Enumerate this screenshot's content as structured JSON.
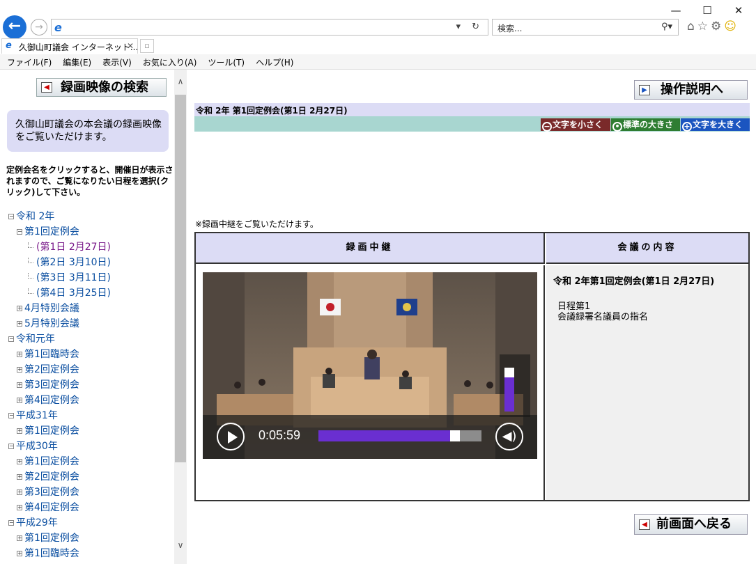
{
  "browser": {
    "tab_title": "久御山町議会 インターネット...",
    "search_placeholder": "検索...",
    "window_minimize": "—",
    "window_maximize": "☐",
    "window_close": "✕",
    "menu": [
      "ファイル(F)",
      "編集(E)",
      "表示(V)",
      "お気に入り(A)",
      "ツール(T)",
      "ヘルプ(H)"
    ]
  },
  "sidebar": {
    "search_button": "録画映像の検索",
    "info": "久御山町議会の本会議の録画映像をご覧いただけます。",
    "instructions": "定例会名をクリックすると、開催日が表示されますので、ご覧になりたい日程を選択(クリック)して下さい。",
    "tree": [
      {
        "label": "令和 2年",
        "level": 0,
        "state": "open"
      },
      {
        "label": "第1回定例会",
        "level": 1,
        "state": "open"
      },
      {
        "label": "(第1日 2月27日)",
        "level": 2,
        "state": "leaf",
        "active": true
      },
      {
        "label": "(第2日 3月10日)",
        "level": 2,
        "state": "leaf"
      },
      {
        "label": "(第3日 3月11日)",
        "level": 2,
        "state": "leaf"
      },
      {
        "label": "(第4日 3月25日)",
        "level": 2,
        "state": "leaf"
      },
      {
        "label": "4月特別会議",
        "level": 1,
        "state": "closed"
      },
      {
        "label": "5月特別会議",
        "level": 1,
        "state": "closed"
      },
      {
        "label": "令和元年",
        "level": 0,
        "state": "open"
      },
      {
        "label": "第1回臨時会",
        "level": 1,
        "state": "closed"
      },
      {
        "label": "第2回定例会",
        "level": 1,
        "state": "closed"
      },
      {
        "label": "第3回定例会",
        "level": 1,
        "state": "closed"
      },
      {
        "label": "第4回定例会",
        "level": 1,
        "state": "closed"
      },
      {
        "label": "平成31年",
        "level": 0,
        "state": "open"
      },
      {
        "label": "第1回定例会",
        "level": 1,
        "state": "closed"
      },
      {
        "label": "平成30年",
        "level": 0,
        "state": "open"
      },
      {
        "label": "第1回定例会",
        "level": 1,
        "state": "closed"
      },
      {
        "label": "第2回定例会",
        "level": 1,
        "state": "closed"
      },
      {
        "label": "第3回定例会",
        "level": 1,
        "state": "closed"
      },
      {
        "label": "第4回定例会",
        "level": 1,
        "state": "closed"
      },
      {
        "label": "平成29年",
        "level": 0,
        "state": "open"
      },
      {
        "label": "第1回定例会",
        "level": 1,
        "state": "closed"
      },
      {
        "label": "第1回臨時会",
        "level": 1,
        "state": "closed"
      }
    ]
  },
  "main": {
    "howto_button": "操作説明へ",
    "session_title": "令和 2年 第1回定例会(第1日 2月27日)",
    "font_small": "文字を小さく",
    "font_standard": "標準の大きさ",
    "font_large": "文字を大きく",
    "note": "※録画中継をご覧いただけます。",
    "col_video": "録画中継",
    "col_content": "会議の内容",
    "content_title": "令和 2年第1回定例会(第1日 2月27日)",
    "agenda_line1": "日程第1",
    "agenda_line2": "会議録署名議員の指名",
    "back_button": "前画面へ戻る",
    "player": {
      "time": "0:05:59",
      "progress": 0.86,
      "volume": 0.85
    }
  }
}
